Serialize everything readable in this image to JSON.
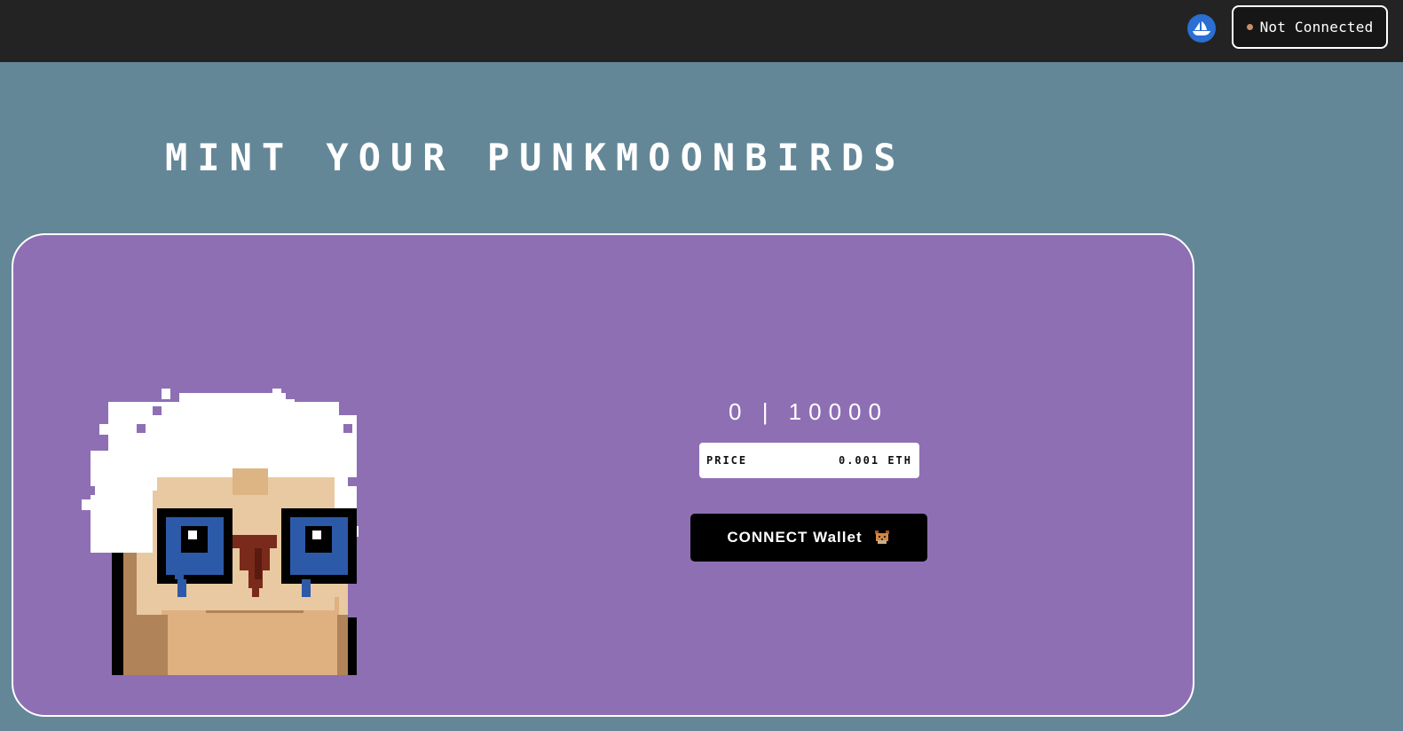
{
  "header": {
    "opensea_icon": "opensea-ship-icon",
    "wallet_status": {
      "label": "Not Connected",
      "dot_color": "#c98f6a"
    }
  },
  "main": {
    "title": "MINT YOUR PUNKMOONBIRDS",
    "nft_image_icon": "punk-moonbird-pixel-art",
    "supply": "0 | 10000",
    "price": {
      "label": "PRICE",
      "value": "0.001 ETH"
    },
    "connect_button": {
      "label": "CONNECT Wallet",
      "icon": "metamask-fox-icon"
    }
  },
  "colors": {
    "background": "#648797",
    "topbar": "#232323",
    "card": "#8e6fb4",
    "button": "#000000",
    "accent_blue": "#2a6fd1"
  }
}
